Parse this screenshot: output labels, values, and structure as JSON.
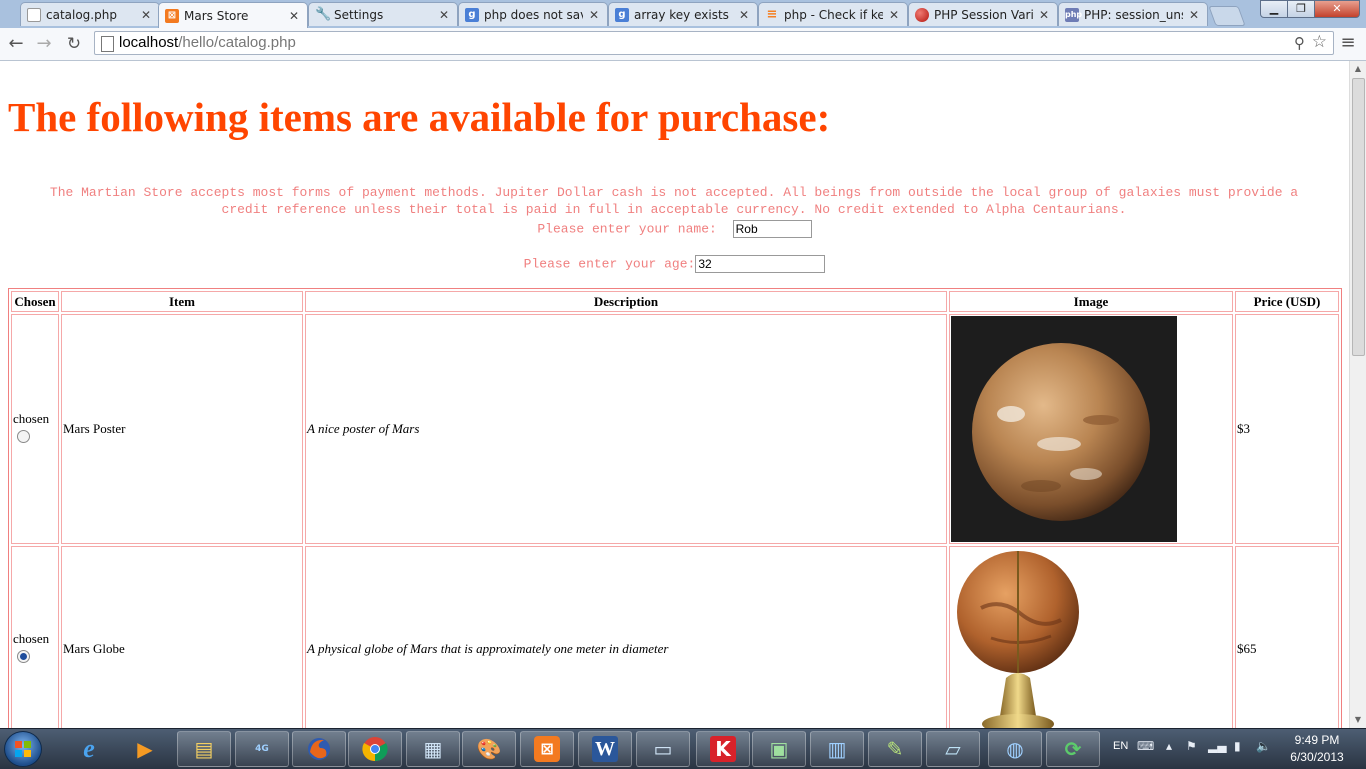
{
  "browser": {
    "tabs": [
      {
        "title": "catalog.php",
        "favicon": "blank-page-icon",
        "color": "#ffffff",
        "active": false
      },
      {
        "title": "Mars Store",
        "favicon": "xampp-icon",
        "color": "#f37a20",
        "active": true
      },
      {
        "title": "Settings",
        "favicon": "wrench-icon",
        "color": "#777777",
        "active": false
      },
      {
        "title": "php does not save",
        "favicon": "google-icon",
        "color": "#4a7fd6",
        "active": false
      },
      {
        "title": "array key exists an",
        "favicon": "google-icon",
        "color": "#4a7fd6",
        "active": false
      },
      {
        "title": "php - Check if key",
        "favicon": "stackoverflow-icon",
        "color": "#f48024",
        "active": false
      },
      {
        "title": "PHP Session Varia",
        "favicon": "red-ball-icon",
        "color": "#d2271f",
        "active": false
      },
      {
        "title": "PHP: session_unse",
        "favicon": "php-icon",
        "color": "#6e7cb5",
        "active": false
      }
    ],
    "url_host": "localhost",
    "url_path": "/hello/catalog.php"
  },
  "page": {
    "heading": "The following items are available for purchase:",
    "intro": "The Martian Store accepts most forms of payment methods. Jupiter Dollar cash is not accepted. All beings from outside the local group of galaxies must provide a credit reference unless their total is paid in full in acceptable currency. No credit extended to Alpha Centaurians.",
    "name_label": "Please enter your name:",
    "name_value": "Rob",
    "age_label": "Please enter your age:",
    "age_value": "32",
    "accent_color": "#ff4500",
    "text_color": "#f08080",
    "table": {
      "headers": [
        "Chosen",
        "Item",
        "Description",
        "Image",
        "Price (USD)"
      ],
      "rows": [
        {
          "chosen_label": "chosen",
          "selected": false,
          "item": "Mars Poster",
          "description": "A nice poster of Mars",
          "image": "mars-poster-image",
          "price": "$3"
        },
        {
          "chosen_label": "chosen",
          "selected": true,
          "item": "Mars Globe",
          "description": "A physical globe of Mars that is approximately one meter in diameter",
          "image": "mars-globe-image",
          "price": "$65"
        }
      ]
    }
  },
  "taskbar": {
    "pinned": [
      "internet-explorer-icon",
      "media-player-icon",
      "file-explorer-icon",
      "4g-wimax-icon",
      "firefox-icon",
      "chrome-icon",
      "calculator-icon",
      "paint-icon",
      "xampp-icon",
      "word-icon",
      "remote-desktop-icon",
      "kaspersky-icon",
      "system-monitor-icon",
      "control-panel-icon",
      "notepad-plus-plus-icon",
      "notepad-icon",
      "network-icon",
      "sync-icon"
    ],
    "language": "EN",
    "time": "9:49 PM",
    "date": "6/30/2013"
  }
}
